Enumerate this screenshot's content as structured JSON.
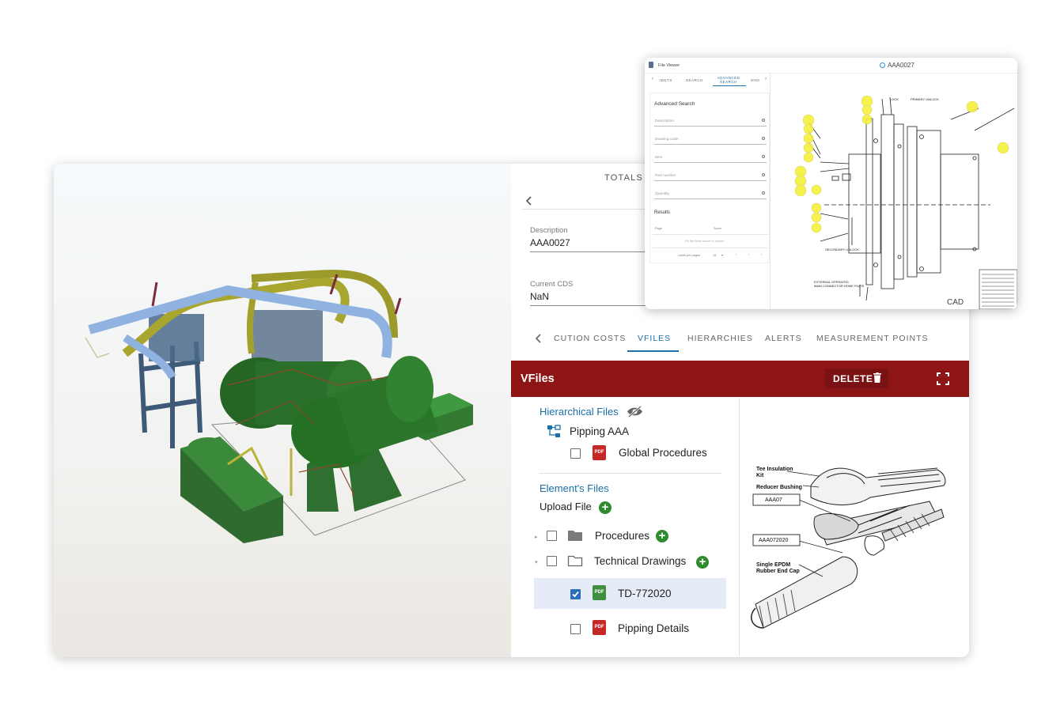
{
  "main_window": {
    "totals_label": "TOTALS",
    "description": {
      "label": "Description",
      "value": "AAA0027"
    },
    "current_cds": {
      "label": "Current CDS",
      "value": "NaN"
    },
    "tabs": [
      {
        "label": "CUTION COSTS",
        "active": false
      },
      {
        "label": "VFILES",
        "active": true
      },
      {
        "label": "HIERARCHIES",
        "active": false
      },
      {
        "label": "ALERTS",
        "active": false
      },
      {
        "label": "MEASUREMENT POINTS",
        "active": false
      }
    ],
    "vfiles": {
      "title": "VFiles",
      "delete_label": "DELETE",
      "hierarchical_files_title": "Hierarchical Files",
      "hierarchy_node": "Pipping AAA",
      "global_procedures": "Global Procedures",
      "elements_files_title": "Element's Files",
      "upload_file": "Upload File",
      "folders": [
        {
          "label": "Procedures"
        },
        {
          "label": "Technical Drawings"
        }
      ],
      "files": [
        {
          "label": "TD-772020",
          "checked": true
        },
        {
          "label": "Pipping Details",
          "checked": false
        }
      ]
    },
    "preview_labels": {
      "tee_insulation_kit": "Tee Insulation Kit",
      "reducer_bushing": "Reducer Bushing",
      "code_1": "AAA07",
      "code_2": "AAA072020",
      "single_epdm": "Single EPDM Rubber End Cap"
    }
  },
  "file_viewer": {
    "title": "File Viewer",
    "code": "AAA0027",
    "tabs": [
      {
        "label": "IENTS",
        "active": false
      },
      {
        "label": "SEARCH",
        "active": false
      },
      {
        "label": "ADVANCED SEARCH",
        "active": true
      },
      {
        "label": "SHO",
        "active": false
      }
    ],
    "advanced_search_title": "Advanced Search",
    "fields": [
      "Description",
      "Drawing code",
      "Item",
      "Part number",
      "Quantity"
    ],
    "results_title": "Results",
    "results_columns": [
      "Page",
      "Score"
    ],
    "results_empty": "Fill the fields above to search",
    "rows_per_page_label": "Limits per pages",
    "rows_per_page_value": "15",
    "drawing_labels": {
      "lock": "LOCK",
      "primary_unlock": "PRIMARY UNLOCK",
      "secondary_unlock": "SECONDARY UNLOCK",
      "external_operated": "EXTERNAL OPERATED",
      "connector_plate": "MAIN CONNECTOR HOME PLATE"
    },
    "viewer_mode": "CAD"
  },
  "colors": {
    "accent_blue": "#1a6fa8",
    "vfiles_bar": "#8d1516",
    "add_green": "#2e8b2e",
    "pdf_red": "#c62828",
    "pdf_green": "#3f8f3f",
    "highlight_yellow": "#f5f03a"
  },
  "icons": [
    "chevron-left-icon",
    "trash-icon",
    "fullscreen-icon",
    "hidden-eye-icon",
    "hierarchy-icon",
    "pdf-icon",
    "folder-icon",
    "folder-open-icon",
    "add-icon",
    "search-icon",
    "cad-icon",
    "document-icon"
  ]
}
